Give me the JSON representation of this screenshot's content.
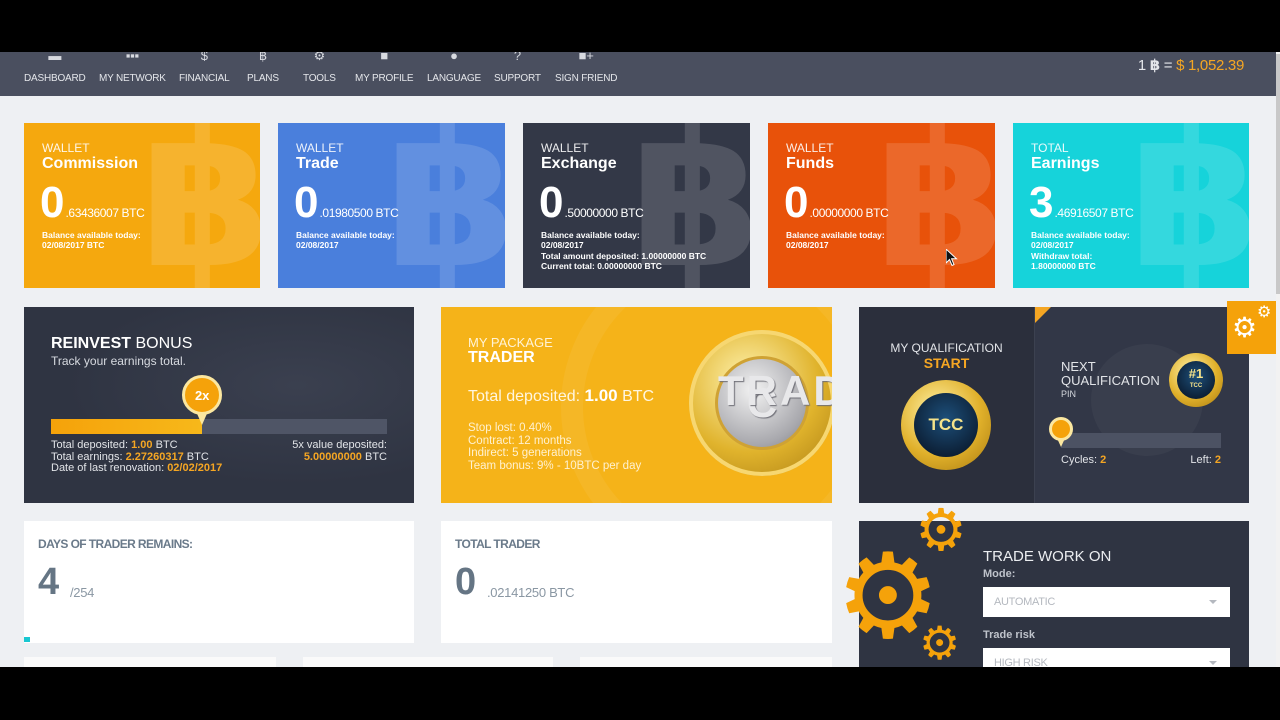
{
  "nav": {
    "items": [
      {
        "label": "DASHBOARD",
        "icon": "monitor-icon"
      },
      {
        "label": "MY NETWORK",
        "icon": "network-icon"
      },
      {
        "label": "FINANCIAL",
        "icon": "dollar-icon"
      },
      {
        "label": "PLANS",
        "icon": "bitcoin-icon"
      },
      {
        "label": "TOOLS",
        "icon": "gear-icon"
      },
      {
        "label": "MY PROFILE",
        "icon": "user-icon"
      },
      {
        "label": "LANGUAGE",
        "icon": "globe-icon"
      },
      {
        "label": "SUPPORT",
        "icon": "question-icon"
      },
      {
        "label": "SIGN FRIEND",
        "icon": "add-user-icon"
      }
    ],
    "rate": {
      "prefix": "1",
      "btc_symbol": "฿",
      "equals": "=",
      "usd": "$ 1,052.39"
    }
  },
  "wallets": [
    {
      "kicker": "WALLET",
      "title": "Commission",
      "int": "0",
      "dec": ".63436007 BTC",
      "info": [
        "Balance available today:",
        "02/08/2017 BTC"
      ],
      "color": "#f5a80e"
    },
    {
      "kicker": "WALLET",
      "title": "Trade",
      "int": "0",
      "dec": ".01980500 BTC",
      "info": [
        "Balance available today:",
        "02/08/2017"
      ],
      "color": "#4a7fdc"
    },
    {
      "kicker": "WALLET",
      "title": "Exchange",
      "int": "0",
      "dec": ".50000000 BTC",
      "info": [
        "Balance available today:",
        "02/08/2017"
      ],
      "extra": [
        "Total amount deposited: 1.00000000 BTC",
        "Current total: 0.00000000 BTC"
      ],
      "color": "#333847"
    },
    {
      "kicker": "WALLET",
      "title": "Funds",
      "int": "0",
      "dec": ".00000000 BTC",
      "info": [
        "Balance available today:",
        "02/08/2017"
      ],
      "color": "#e8520a"
    },
    {
      "kicker": "TOTAL",
      "title": "Earnings",
      "int": "3",
      "dec": ".46916507 BTC",
      "info": [
        "Balance available today:",
        "02/08/2017"
      ],
      "extra": [
        "Withdraw total:",
        "1.80000000 BTC"
      ],
      "color": "#16d3da"
    }
  ],
  "reinvest": {
    "title_bold": "REINVEST",
    "title_rest": "BONUS",
    "subtitle": "Track your earnings total.",
    "marker_label": "2x",
    "progress_percent": 45,
    "deposited_label": "Total deposited:",
    "deposited_value": "1.00",
    "earnings_label": "Total earnings:",
    "earnings_value": "2.27260317",
    "btc": "BTC",
    "renovation_label": "Date of last renovation:",
    "renovation_value": "02/02/2017",
    "target_label": "5x value deposited:",
    "target_value": "5.00000000"
  },
  "package": {
    "kicker": "MY PACKAGE",
    "title": "TRADER",
    "deposit_label": "Total deposited:",
    "deposit_value": "1.00",
    "deposit_unit": "BTC",
    "lines": [
      "Stop lost: 0.40%",
      "Contract: 12 months",
      "Indirect: 5 generations",
      "Team bonus: 9% - 10BTC per day"
    ],
    "coin_text": "TRADER",
    "coin_symbol": "C"
  },
  "qualification": {
    "kicker": "MY QUALIFICATION",
    "level": "START",
    "medal_text": "TCC",
    "next_title_1": "NEXT",
    "next_title_2": "QUALIFICATION",
    "next_sub": "PIN",
    "next_medal_top": "#1",
    "next_medal_bottom": "TCC",
    "progress_percent": 0,
    "cycles_label": "Cycles:",
    "cycles_value": "2",
    "left_label": "Left:",
    "left_value": "2"
  },
  "stats": {
    "days": {
      "title": "DAYS OF TRADER REMAINS:",
      "big": "4",
      "small": "/254"
    },
    "total": {
      "title": "TOTAL TRADER",
      "big": "0",
      "small": ".02141250 BTC"
    }
  },
  "trade": {
    "title": "TRADE WORK ON",
    "mode_label": "Mode:",
    "mode_value": "AUTOMATIC",
    "risk_label": "Trade risk",
    "risk_value": "HIGH RISK"
  },
  "colors": {
    "accent": "#f5a623",
    "nav_bg": "#4a4f5f",
    "dark_panel": "#2f3442"
  }
}
